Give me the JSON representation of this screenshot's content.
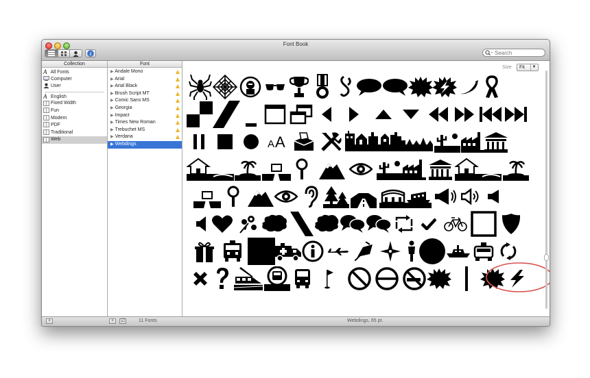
{
  "window": {
    "title": "Font Book",
    "traffic_lights": [
      "close",
      "minimize",
      "zoom"
    ]
  },
  "toolbar": {
    "view_buttons": [
      "list-view",
      "grid-view",
      "user"
    ],
    "info_button": "info",
    "search": {
      "placeholder": "Search",
      "value": ""
    }
  },
  "collections": {
    "header": "Collection",
    "items": [
      {
        "label": "All Fonts",
        "icon": "font-icon"
      },
      {
        "label": "Computer",
        "icon": "computer-icon"
      },
      {
        "label": "User",
        "icon": "user-icon"
      },
      {
        "label": "English",
        "icon": "font-icon"
      },
      {
        "label": "Fixed Width",
        "icon": "book-icon"
      },
      {
        "label": "Fun",
        "icon": "book-icon"
      },
      {
        "label": "Modern",
        "icon": "book-icon"
      },
      {
        "label": "PDF",
        "icon": "book-icon"
      },
      {
        "label": "Traditional",
        "icon": "book-icon"
      },
      {
        "label": "Web",
        "icon": "book-icon",
        "selected": true
      }
    ]
  },
  "fonts": {
    "header": "Font",
    "items": [
      {
        "label": "Andale Mono",
        "warning": true
      },
      {
        "label": "Arial",
        "warning": true
      },
      {
        "label": "Arial Black",
        "warning": true
      },
      {
        "label": "Brush Script MT",
        "warning": true
      },
      {
        "label": "Comic Sans MS",
        "warning": true
      },
      {
        "label": "Georgia",
        "warning": true
      },
      {
        "label": "Impact",
        "warning": true
      },
      {
        "label": "Times New Roman",
        "warning": true
      },
      {
        "label": "Trebuchet MS",
        "warning": true
      },
      {
        "label": "Verdana",
        "warning": true
      },
      {
        "label": "Webdings",
        "warning": false,
        "selected": true
      }
    ]
  },
  "preview": {
    "size_label": "Size",
    "size_value": "Fit",
    "glyph_rows": [
      [
        "spider",
        "web",
        "person-in-bubble",
        "sunglasses",
        "trophy",
        "medal",
        "chain",
        "speech-bubble",
        "speech-bubble",
        "burst",
        "lightning-burst",
        "chili-pepper",
        "ribbon"
      ],
      [
        "checkerboard",
        "slash-block",
        "underscore",
        "window",
        "overlapping-windows",
        "triangle-left",
        "triangle-right",
        "triangle-up",
        "triangle-down",
        "fast-rewind",
        "fast-forward",
        "skip-back",
        "skip-forward"
      ],
      [
        "pause",
        "stop",
        "record",
        "small-text",
        "package",
        "tools",
        "city-skyline",
        "houses",
        "city",
        "desert",
        "factory",
        "government-building"
      ],
      [
        "house",
        "island",
        "road",
        "magnifying-glass",
        "mountain",
        "eye",
        "desert",
        "factory",
        "government-building",
        "house",
        "island"
      ],
      [
        "road",
        "magnifying-glass",
        "mountain",
        "eye",
        "ear",
        "trees",
        "highway",
        "stadium",
        "ship",
        "megaphone",
        "speaker",
        "speaker"
      ],
      [
        "mute",
        "heart",
        "flowers",
        "thought-bubble",
        "slash",
        "thought-bubble",
        "chat-bubbles",
        "chat-bubbles",
        "recycle",
        "checkmark",
        "bicycle",
        "frame",
        "shield"
      ],
      [
        "gift",
        "fire-truck",
        "black-square",
        "ambulance",
        "information",
        "airplane",
        "satellite",
        "compass-star",
        "person",
        "black-circle",
        "boat",
        "police-car",
        "refresh"
      ],
      [
        "cross",
        "question",
        "train",
        "bus-sign",
        "bus",
        "golf-flag",
        "prohibited",
        "no-entry",
        "no-smoking",
        "burst",
        "vertical-bar",
        "burst",
        "lightning-bolt"
      ]
    ],
    "annotation": "red-circle-highlight"
  },
  "status": {
    "font_count": "11 Fonts",
    "selection": "Webdings, 65 pt."
  },
  "colors": {
    "selection_blue": "#3875d7",
    "warning_yellow": "#e8b82a",
    "highlight_red": "#d9534f"
  }
}
